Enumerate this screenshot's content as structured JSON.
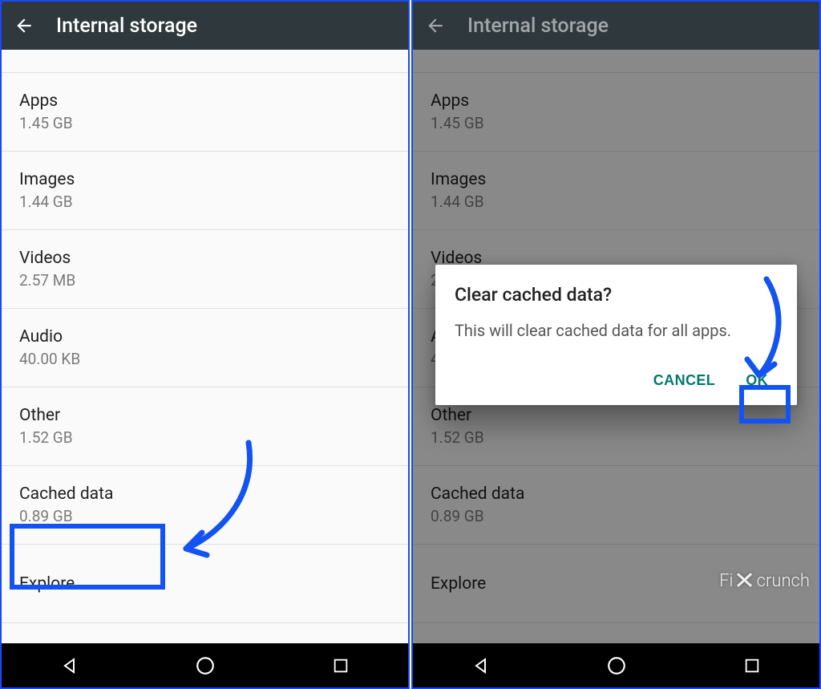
{
  "header": {
    "title": "Internal storage"
  },
  "items": [
    {
      "label": "Apps",
      "size": "1.45 GB"
    },
    {
      "label": "Images",
      "size": "1.44 GB"
    },
    {
      "label": "Videos",
      "size": "2.57 MB"
    },
    {
      "label": "Audio",
      "size": "40.00 KB"
    },
    {
      "label": "Other",
      "size": "1.52 GB"
    },
    {
      "label": "Cached data",
      "size": "0.89 GB"
    },
    {
      "label": "Explore",
      "size": ""
    }
  ],
  "dialog": {
    "title": "Clear cached data?",
    "body": "This will clear cached data for all apps.",
    "cancel": "CANCEL",
    "ok": "OK"
  },
  "watermark": {
    "left": "Fi",
    "right": "crunch"
  }
}
